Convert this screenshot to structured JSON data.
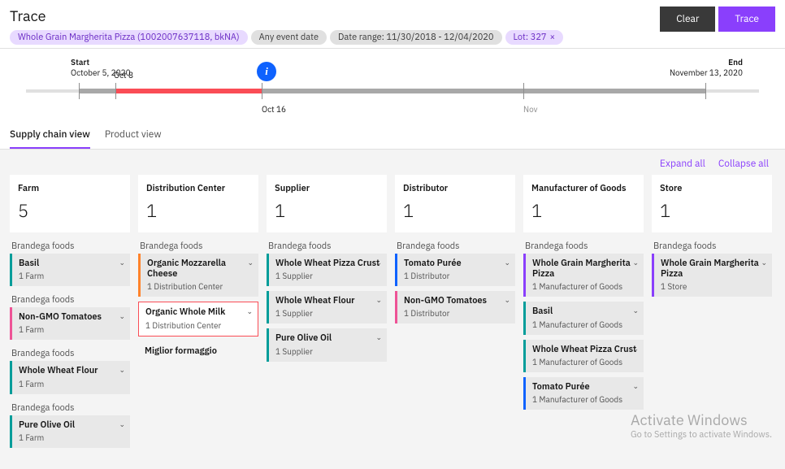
{
  "header": {
    "title": "Trace",
    "chips": {
      "product": "Whole Grain Margherita Pizza (1002007637118, bkNA)",
      "event": "Any event date",
      "range": "Date range: 11/30/2018 - 12/04/2020",
      "lot": "Lot: 327"
    },
    "buttons": {
      "clear": "Clear",
      "trace": "Trace"
    }
  },
  "timeline": {
    "start_label": "Start",
    "start_date": "October 5, 2020",
    "end_label": "End",
    "end_date": "November 13, 2020",
    "marker_top": "Oct 8",
    "marker_bottom": "Oct 16",
    "month": "Nov"
  },
  "tabs": {
    "supply": "Supply chain view",
    "product": "Product view"
  },
  "controls": {
    "expand": "Expand all",
    "collapse": "Collapse all"
  },
  "columns": [
    {
      "title": "Farm",
      "count": "5",
      "groups": [
        {
          "label": "Brandega foods",
          "items": [
            {
              "title": "Basil",
              "sub": "1 Farm",
              "color": "teal"
            }
          ]
        },
        {
          "label": "Brandega foods",
          "items": [
            {
              "title": "Non-GMO Tomatoes",
              "sub": "1 Farm",
              "color": "pink"
            }
          ]
        },
        {
          "label": "Brandega foods",
          "items": [
            {
              "title": "Whole Wheat Flour",
              "sub": "1 Farm",
              "color": "teal"
            }
          ]
        },
        {
          "label": "Brandega foods",
          "items": [
            {
              "title": "Pure Olive Oil",
              "sub": "1 Farm",
              "color": "teal"
            }
          ]
        }
      ]
    },
    {
      "title": "Distribution Center",
      "count": "1",
      "groups": [
        {
          "label": "Brandega foods",
          "items": [
            {
              "title": "Organic Mozzarella Cheese",
              "sub": "1 Distribution Center",
              "color": "orange"
            }
          ]
        },
        {
          "label": "",
          "items": [
            {
              "title": "Organic Whole Milk",
              "sub": "1 Distribution Center",
              "color": "red-outline"
            }
          ]
        },
        {
          "label": "",
          "items": [
            {
              "title": "Miglior formaggio",
              "sub": "",
              "color": "plain"
            }
          ]
        }
      ]
    },
    {
      "title": "Supplier",
      "count": "1",
      "groups": [
        {
          "label": "Brandega foods",
          "items": [
            {
              "title": "Whole Wheat Pizza Crust",
              "sub": "1 Supplier",
              "color": "teal"
            },
            {
              "title": "Whole Wheat Flour",
              "sub": "1 Supplier",
              "color": "teal"
            },
            {
              "title": "Pure Olive Oil",
              "sub": "1 Supplier",
              "color": "teal"
            }
          ]
        }
      ]
    },
    {
      "title": "Distributor",
      "count": "1",
      "groups": [
        {
          "label": "Brandega foods",
          "items": [
            {
              "title": "Tomato Purée",
              "sub": "1 Distributor",
              "color": "blue"
            },
            {
              "title": "Non-GMO Tomatoes",
              "sub": "1 Distributor",
              "color": "pink"
            }
          ]
        }
      ]
    },
    {
      "title": "Manufacturer of Goods",
      "count": "1",
      "groups": [
        {
          "label": "Brandega foods",
          "items": [
            {
              "title": "Whole Grain Margherita Pizza",
              "sub": "1 Manufacturer of Goods",
              "color": "purple"
            },
            {
              "title": "Basil",
              "sub": "1 Manufacturer of Goods",
              "color": "teal"
            },
            {
              "title": "Whole Wheat Pizza Crust",
              "sub": "1 Manufacturer of Goods",
              "color": "teal"
            },
            {
              "title": "Tomato Purée",
              "sub": "1 Manufacturer of Goods",
              "color": "blue"
            }
          ]
        }
      ]
    },
    {
      "title": "Store",
      "count": "1",
      "groups": [
        {
          "label": "Brandega foods",
          "items": [
            {
              "title": "Whole Grain Margherita Pizza",
              "sub": "1 Store",
              "color": "purple"
            }
          ]
        }
      ]
    }
  ],
  "watermark": {
    "line1": "Activate Windows",
    "line2": "Go to Settings to activate Windows."
  }
}
